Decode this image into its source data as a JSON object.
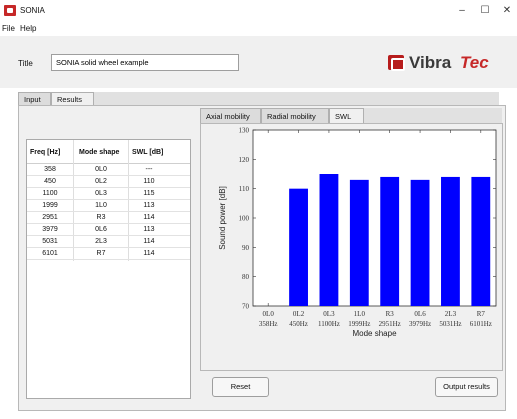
{
  "window": {
    "title": "SONIA",
    "minimize_glyph": "–",
    "maximize_glyph": "☐",
    "close_glyph": "✕"
  },
  "menu": [
    "File",
    "Help"
  ],
  "header": {
    "title_label": "Title",
    "title_value": "SONIA solid wheel example",
    "logo_part1": "Vibra",
    "logo_part2": "Tec"
  },
  "outer_tabs": [
    "Input",
    "Results"
  ],
  "inner_tabs": [
    "Axial mobility",
    "Radial mobility",
    "SWL"
  ],
  "table": {
    "columns": [
      "Freq [Hz]",
      "Mode shape",
      "SWL [dB]"
    ],
    "rows": [
      [
        "358",
        "0L0",
        "---"
      ],
      [
        "450",
        "0L2",
        "110"
      ],
      [
        "1100",
        "0L3",
        "115"
      ],
      [
        "1999",
        "1L0",
        "113"
      ],
      [
        "2951",
        "R3",
        "114"
      ],
      [
        "3979",
        "0L6",
        "113"
      ],
      [
        "5031",
        "2L3",
        "114"
      ],
      [
        "6101",
        "R7",
        "114"
      ]
    ]
  },
  "buttons": {
    "reset": "Reset",
    "output": "Output results"
  },
  "chart_data": {
    "type": "bar",
    "categories": [
      "0L0\n358Hz",
      "0L2\n450Hz",
      "0L3\n1100Hz",
      "1L0\n1999Hz",
      "R3\n2951Hz",
      "0L6\n3979Hz",
      "2L3\n5031Hz",
      "R7\n6101Hz"
    ],
    "category_top": [
      "0L0",
      "0L2",
      "0L3",
      "1L0",
      "R3",
      "0L6",
      "2L3",
      "R7"
    ],
    "category_bottom": [
      "358Hz",
      "450Hz",
      "1100Hz",
      "1999Hz",
      "2951Hz",
      "3979Hz",
      "5031Hz",
      "6101Hz"
    ],
    "values": [
      null,
      110,
      115,
      113,
      114,
      113,
      114,
      114
    ],
    "xlabel": "Mode shape",
    "ylabel": "Sound power [dB]",
    "ylim": [
      70,
      130
    ],
    "yticks": [
      "70",
      "80",
      "90",
      "100",
      "110",
      "120",
      "130"
    ],
    "bar_color": "#0000ff",
    "grid": false
  }
}
